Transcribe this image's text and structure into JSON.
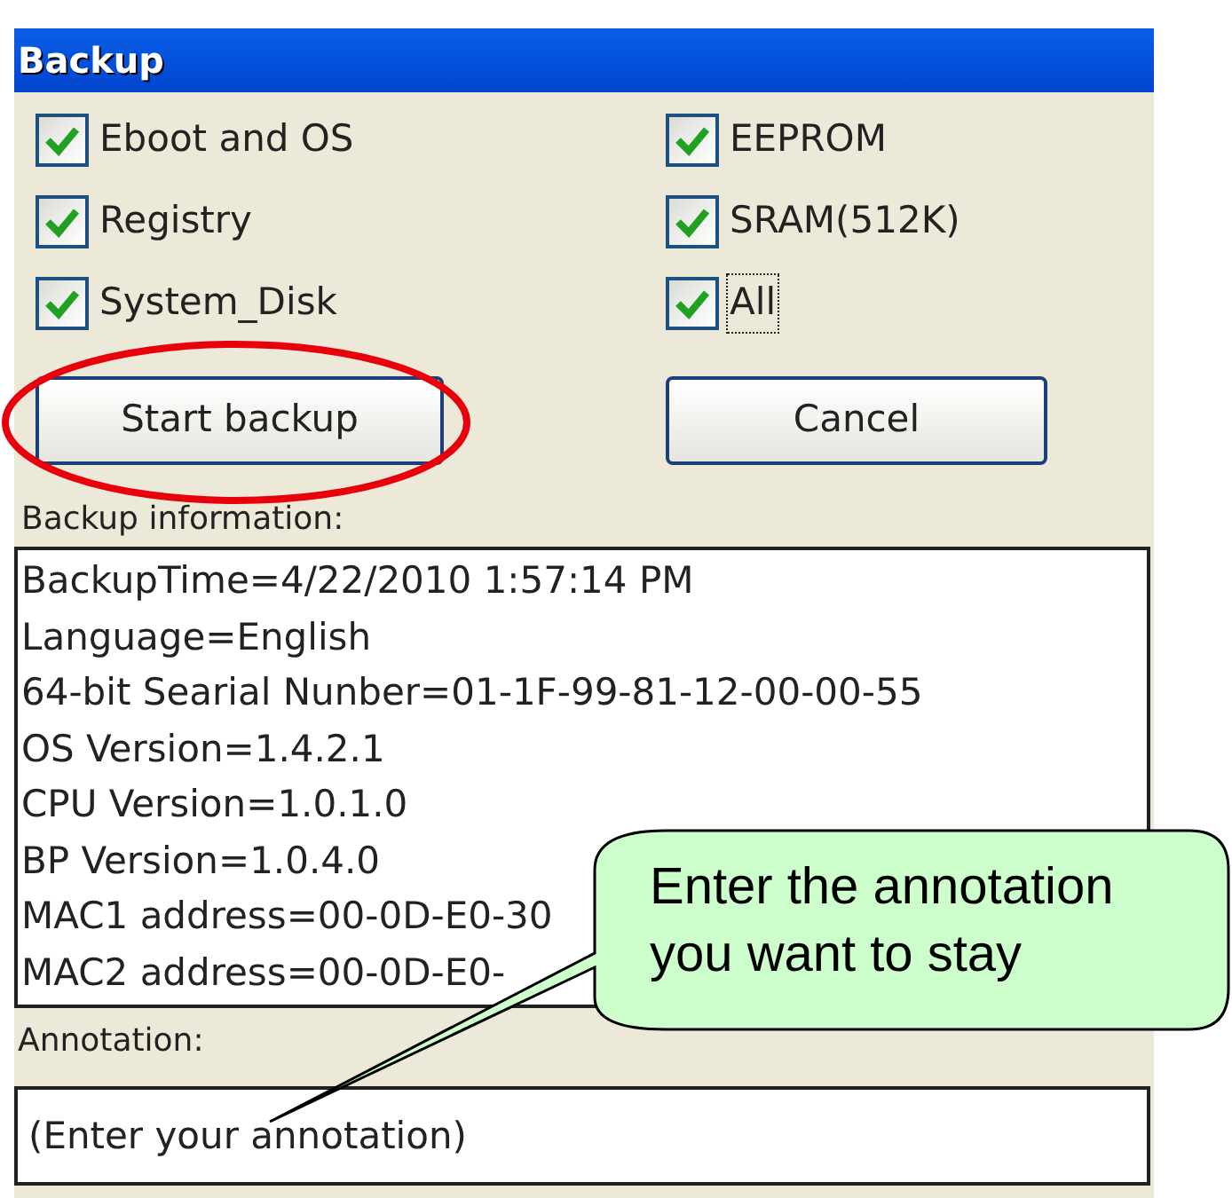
{
  "window": {
    "title": "Backup"
  },
  "options": [
    {
      "label": "Eboot and OS",
      "checked": true,
      "focused": false
    },
    {
      "label": "EEPROM",
      "checked": true,
      "focused": false
    },
    {
      "label": "Registry",
      "checked": true,
      "focused": false
    },
    {
      "label": "SRAM(512K)",
      "checked": true,
      "focused": false
    },
    {
      "label": "System_Disk",
      "checked": true,
      "focused": false
    },
    {
      "label": "All",
      "checked": true,
      "focused": true
    }
  ],
  "buttons": [
    "Start backup",
    "Cancel"
  ],
  "info": {
    "label": "Backup information:",
    "lines": [
      "BackupTime=4/22/2010 1:57:14 PM",
      "Language=English",
      "64-bit Searial Nunber=01-1F-99-81-12-00-00-55",
      "OS Version=1.4.2.1",
      "CPU Version=1.0.1.0",
      "BP Version=1.0.4.0",
      "MAC1 address=00-0D-E0-30",
      "MAC2 address=00-0D-E0-"
    ]
  },
  "annotation": {
    "label": "Annotation:",
    "placeholder": "(Enter your annotation)"
  },
  "callout": {
    "text": "Enter the annotation\nyou want to stay"
  }
}
